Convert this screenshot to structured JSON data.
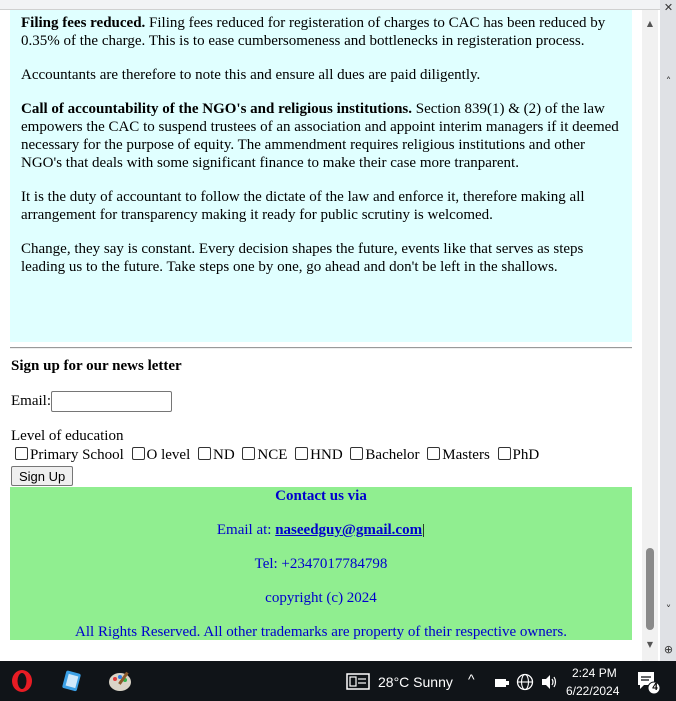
{
  "article": {
    "p1_bold": "Filing fees reduced.",
    "p1_text": " Filing fees reduced for registeration of charges to CAC has been reduced by 0.35% of the charge. This is to ease cumbersomeness and bottlenecks in registeration process.",
    "p2_text": "Accountants are therefore to note this and ensure all dues are paid diligently.",
    "p3_bold": "Call of accountability of the NGO's and religious institutions.",
    "p3_text": " Section 839(1) & (2) of the law empowers the CAC to suspend trustees of an association and appoint interim managers if it deemed necessary for the purpose of equity. The ammendment requires religious institutions and other NGO's that deals with some significant finance to make their case more tranparent.",
    "p4_text": "It is the duty of accountant to follow the dictate of the law and enforce it, therefore making all arrangement for transparency making it ready for public scrutiny is welcomed.",
    "p5_text": "Change, they say is constant. Every decision shapes the future, events like that serves as steps leading us to the future. Take steps one by one, go ahead and don't be left in the shallows."
  },
  "newsletter": {
    "heading": "Sign up for our news letter",
    "email_label": "Email:",
    "email_value": "",
    "education_label": "Level of education",
    "education_options": [
      "Primary School",
      "O level",
      "ND",
      "NCE",
      "HND",
      "Bachelor",
      "Masters",
      "PhD"
    ],
    "submit_label": "Sign Up"
  },
  "contact": {
    "heading": "Contact us via",
    "email_prefix": "Email at: ",
    "email": "naseedguy@gmail.com",
    "email_suffix": "|",
    "phone": "Tel: +2347017784798",
    "copyright": "copyright (c) 2024",
    "rights": "All Rights Reserved. All other trademarks are property of their respective owners."
  },
  "taskbar": {
    "weather": "28°C  Sunny",
    "time": "2:24 PM",
    "date": "6/22/2024",
    "notification_count": "4"
  },
  "colors": {
    "article_bg": "#e0ffff",
    "contact_bg": "#90ee90",
    "contact_text": "#0000cd",
    "taskbar_bg": "#101418"
  },
  "icons": [
    "opera-icon",
    "notepad-icon",
    "paint-icon",
    "weather-icon",
    "chevron-up-icon",
    "network-icon",
    "globe-icon",
    "volume-icon",
    "notification-icon"
  ]
}
